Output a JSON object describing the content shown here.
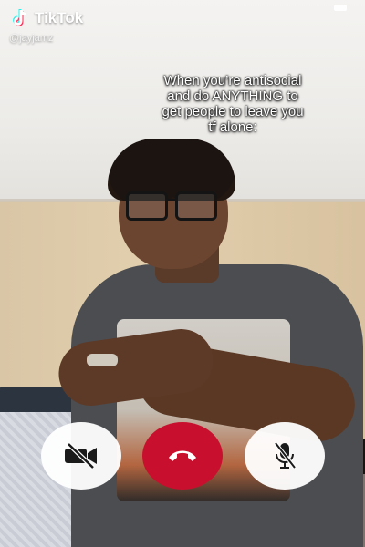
{
  "app": {
    "name": "TikTok"
  },
  "user": {
    "handle": "@jayjamz"
  },
  "caption": "When you’re antisocial\nand do ANYTHING to\nget people to leave you\ntf alone:",
  "call_controls": {
    "video": {
      "icon": "video-off-icon"
    },
    "end": {
      "icon": "hang-up-icon",
      "color": "#c8102e"
    },
    "mic": {
      "icon": "mic-off-icon"
    }
  }
}
